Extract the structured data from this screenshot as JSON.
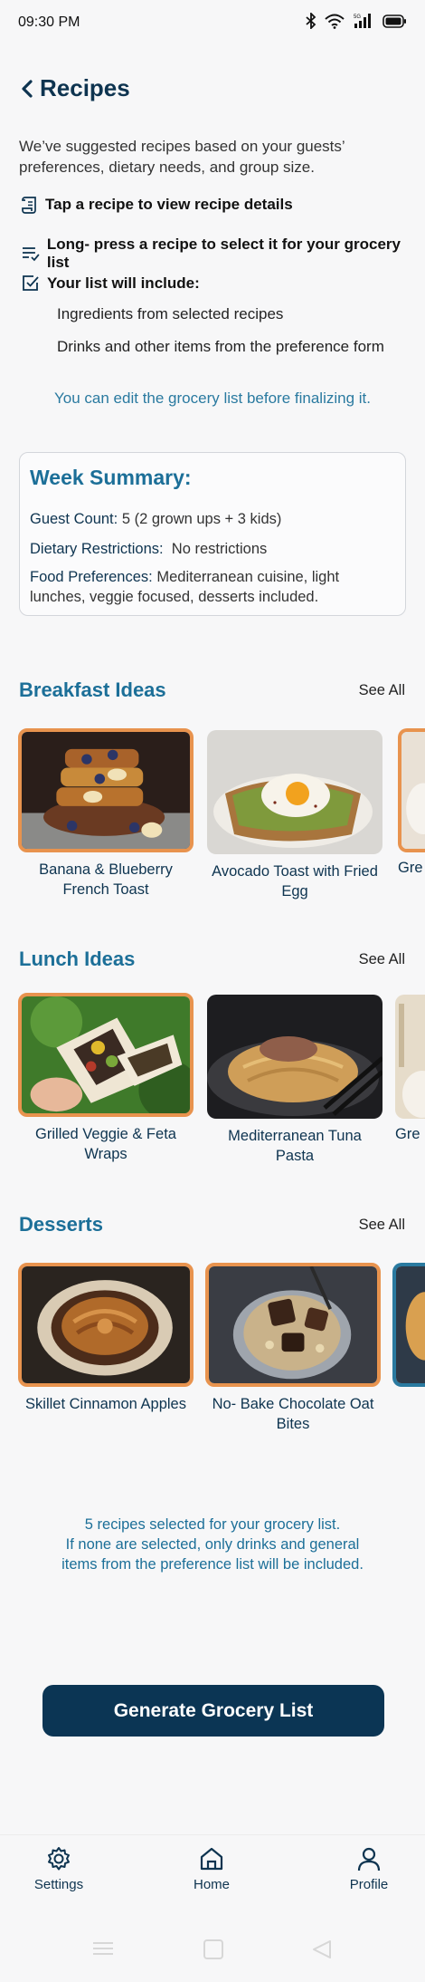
{
  "status_bar": {
    "time": "09:30 PM",
    "network": "5G"
  },
  "header": {
    "title": "Recipes"
  },
  "intro": {
    "text": "We’ve suggested recipes based on your guests’ preferences, dietary needs, and group size.",
    "hint_tap": "Tap a recipe to view recipe details",
    "hint_long_press": "Long- press a recipe to select it for your grocery list",
    "include_heading": "Your list will include:",
    "include_items": [
      "Ingredients from selected recipes",
      "Drinks and other items from the preference form"
    ],
    "edit_note": "You can edit the grocery list before finalizing it."
  },
  "summary": {
    "title": "Week Summary:",
    "guest_count_label": "Guest Count:",
    "guest_count_value": "5 (2 grown ups + 3 kids)",
    "dietary_label": "Dietary Restrictions:",
    "dietary_value": "No restrictions",
    "food_pref_label": "Food Preferences:",
    "food_pref_value": "Mediterranean cuisine, light lunches, veggie focused, desserts included."
  },
  "sections": [
    {
      "title": "Breakfast Ideas",
      "see_all": "See All",
      "recipes": [
        {
          "name": "Banana & Blueberry French Toast",
          "selected": true
        },
        {
          "name": "Avocado Toast with Fried Egg",
          "selected": false
        }
      ],
      "peek": {
        "label": "Gre",
        "selected": true
      }
    },
    {
      "title": "Lunch Ideas",
      "see_all": "See All",
      "recipes": [
        {
          "name": "Grilled Veggie & Feta Wraps",
          "selected": true
        },
        {
          "name": "Mediterranean Tuna Pasta",
          "selected": false
        }
      ],
      "peek": {
        "label": "Gre",
        "selected": false
      }
    },
    {
      "title": "Desserts",
      "see_all": "See All",
      "recipes": [
        {
          "name": "Skillet Cinnamon Apples",
          "selected": true
        },
        {
          "name": "No- Bake Chocolate Oat Bites",
          "selected": true
        }
      ],
      "peek": {
        "label": "",
        "selected": true
      }
    }
  ],
  "footer_note": {
    "line1": "5 recipes selected for your grocery list.",
    "line2": "If none are selected, only drinks and general items from the preference list will be included."
  },
  "generate_button": "Generate Grocery List",
  "nav": {
    "settings": "Settings",
    "home": "Home",
    "profile": "Profile"
  },
  "colors": {
    "primary": "#0b3554",
    "accent": "#1c6f98",
    "selected_border": "#e8934e"
  }
}
